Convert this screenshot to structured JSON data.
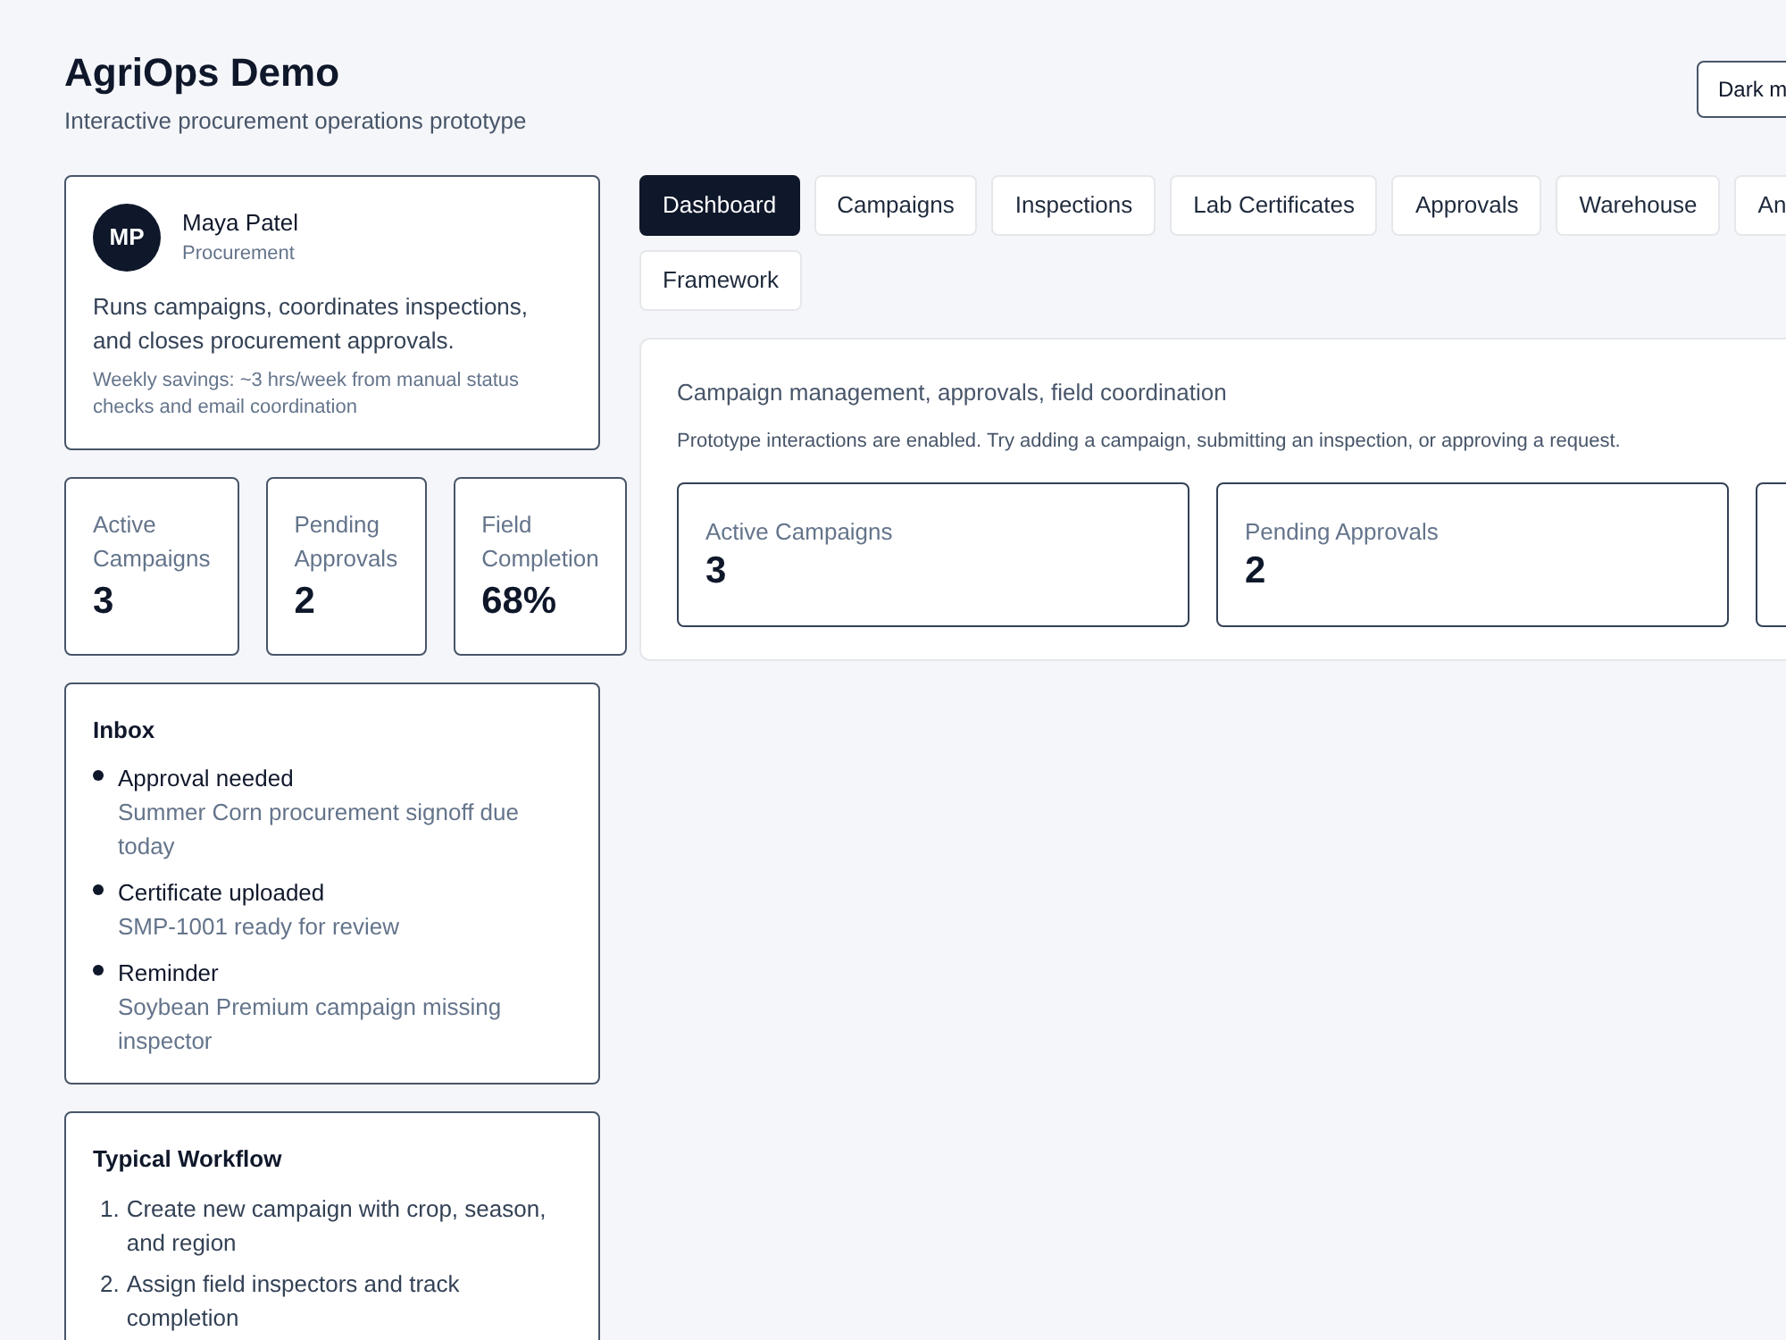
{
  "header": {
    "title": "AgriOps Demo",
    "subtitle": "Interactive procurement operations prototype",
    "theme_button": "Dark m"
  },
  "profile": {
    "initials": "MP",
    "name": "Maya Patel",
    "role": "Procurement",
    "description": "Runs campaigns, coordinates inspections, and closes procurement approvals.",
    "savings": "Weekly savings: ~3 hrs/week from manual status checks and email coordination"
  },
  "side_stats": [
    {
      "label": "Active Campaigns",
      "value": "3"
    },
    {
      "label": "Pending Approvals",
      "value": "2"
    },
    {
      "label": "Field Completion",
      "value": "68%"
    }
  ],
  "inbox": {
    "title": "Inbox",
    "items": [
      {
        "title": "Approval needed",
        "detail": "Summer Corn procurement signoff due today"
      },
      {
        "title": "Certificate uploaded",
        "detail": "SMP-1001 ready for review"
      },
      {
        "title": "Reminder",
        "detail": "Soybean Premium campaign missing inspector"
      }
    ]
  },
  "workflow": {
    "title": "Typical Workflow",
    "steps": [
      {
        "number": "1.",
        "text": "Create new campaign with crop, season, and region"
      },
      {
        "number": "2.",
        "text": "Assign field inspectors and track completion"
      }
    ]
  },
  "tabs": [
    {
      "label": "Dashboard",
      "selected": true
    },
    {
      "label": "Campaigns",
      "selected": false
    },
    {
      "label": "Inspections",
      "selected": false
    },
    {
      "label": "Lab Certificates",
      "selected": false
    },
    {
      "label": "Approvals",
      "selected": false
    },
    {
      "label": "Warehouse",
      "selected": false
    },
    {
      "label": "An",
      "selected": false
    },
    {
      "label": "Framework",
      "selected": false
    }
  ],
  "overview": {
    "heading": "Campaign management, approvals, field coordination",
    "note": "Prototype interactions are enabled. Try adding a campaign, submitting an inspection, or approving a request.",
    "stats": [
      {
        "label": "Active Campaigns",
        "value": "3"
      },
      {
        "label": "Pending Approvals",
        "value": "2"
      }
    ],
    "clipped_card": true
  }
}
